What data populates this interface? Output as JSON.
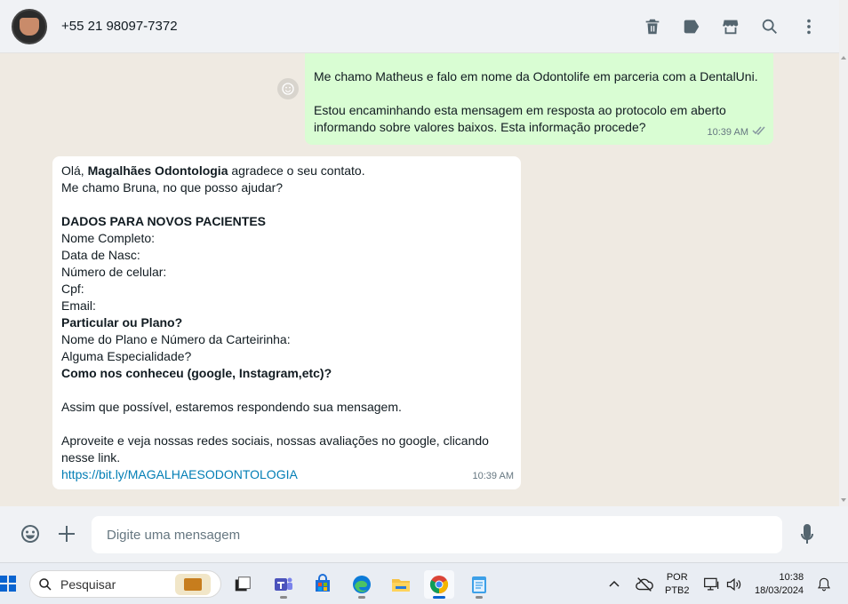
{
  "header": {
    "contact_name": "+55 21 98097-7372",
    "icons": [
      "delete-icon",
      "label-icon",
      "store-icon",
      "search-icon",
      "menu-icon"
    ]
  },
  "messages": {
    "outgoing": {
      "lines": [
        "Me chamo Matheus e falo em nome da Odontolife em parceria com a DentalUni.",
        "",
        "Estou encaminhando esta mensagem em resposta ao protocolo em aberto",
        "informando sobre valores baixos. Esta informação procede?"
      ],
      "time": "10:39 AM"
    },
    "incoming": {
      "greeting_prefix": "Olá, ",
      "greeting_name": "Magalhães Odontologia",
      "greeting_suffix": " agradece o seu contato.",
      "line2": "Me chamo Bruna, no que posso ajudar?",
      "section_title": "DADOS PARA NOVOS PACIENTES",
      "fields": [
        "Nome Completo:",
        "Data de Nasc:",
        "Número de celular:",
        "Cpf:",
        "Email:"
      ],
      "question1": "Particular ou Plano?",
      "field_plan": "Nome do Plano e Número da Carteirinha:",
      "field_specialty": "Alguma Especialidade?",
      "question2": "Como nos conheceu (google, Instagram,etc)?",
      "reply_note": "Assim que possível, estaremos respondendo sua mensagem.",
      "social_line1": "Aproveite e veja nossas redes sociais, nossas avaliações no google, clicando",
      "social_line2": "nesse link.",
      "link": "https://bit.ly/MAGALHAESODONTOLOGIA",
      "time": "10:39 AM"
    }
  },
  "composer": {
    "placeholder": "Digite uma mensagem"
  },
  "taskbar": {
    "search_label": "Pesquisar",
    "language_line1": "POR",
    "language_line2": "PTB2",
    "clock_time": "10:38",
    "clock_date": "18/03/2024"
  },
  "colors": {
    "outgoing_bubble": "#d9fdd3",
    "incoming_bubble": "#ffffff",
    "link": "#027eb5",
    "chat_background": "#efeae2"
  }
}
